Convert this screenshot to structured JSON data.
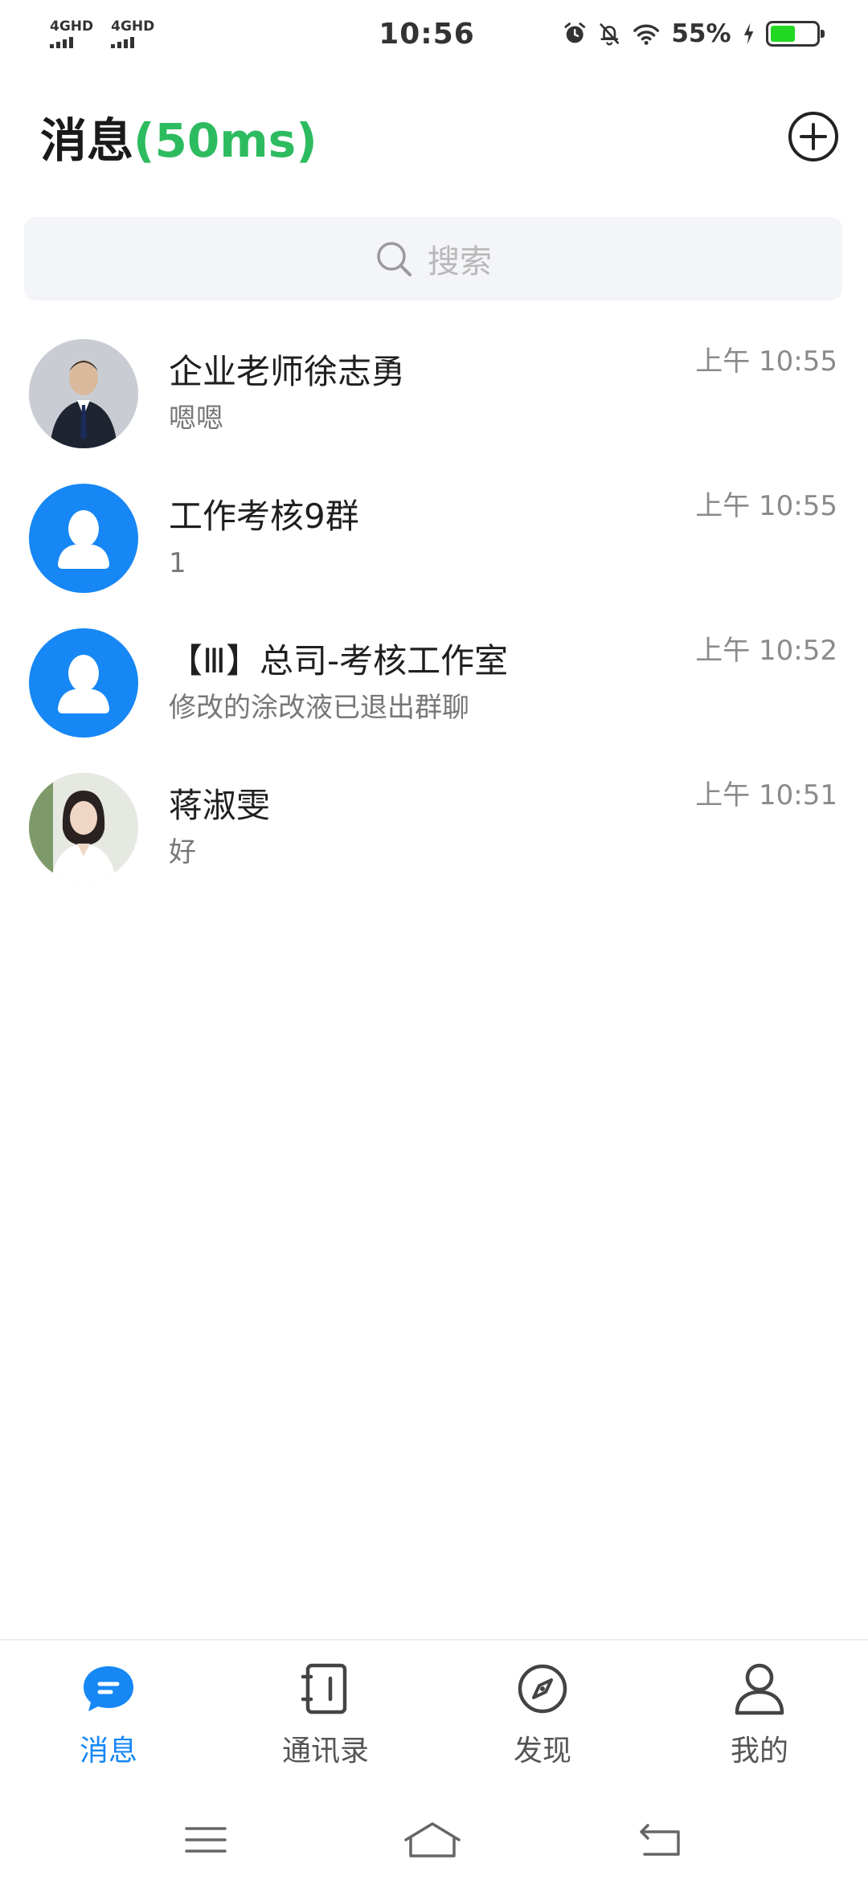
{
  "status_bar": {
    "sim1": "4GHD",
    "sim2": "4GHD",
    "time": "10:56",
    "battery_percent": "55%",
    "battery_level": 0.55,
    "icons": [
      "alarm-icon",
      "bell-off-icon",
      "wifi-icon",
      "charging-icon"
    ]
  },
  "header": {
    "title": "消息",
    "latency": "(50ms)",
    "add_icon": "plus-circle-icon"
  },
  "search": {
    "placeholder": "搜索",
    "icon": "search-icon"
  },
  "conversations": [
    {
      "name": "企业老师徐志勇",
      "preview": "嗯嗯",
      "time": "上午 10:55",
      "avatar": "photo"
    },
    {
      "name": "工作考核9群",
      "preview": "1",
      "time": "上午 10:55",
      "avatar": "default-user"
    },
    {
      "name": "【Ⅲ】总司-考核工作室",
      "preview": "修改的涂改液已退出群聊",
      "time": "上午 10:52",
      "avatar": "default-user"
    },
    {
      "name": "蒋淑雯",
      "preview": "好",
      "time": "上午 10:51",
      "avatar": "photo"
    }
  ],
  "bottom_nav": {
    "items": [
      {
        "label": "消息",
        "icon": "message-icon",
        "active": true
      },
      {
        "label": "通讯录",
        "icon": "contacts-icon",
        "active": false
      },
      {
        "label": "发现",
        "icon": "compass-icon",
        "active": false
      },
      {
        "label": "我的",
        "icon": "user-icon",
        "active": false
      }
    ]
  },
  "colors": {
    "accent": "#1687f5",
    "latency_green": "#2dbb5f",
    "battery_green": "#22d822"
  }
}
